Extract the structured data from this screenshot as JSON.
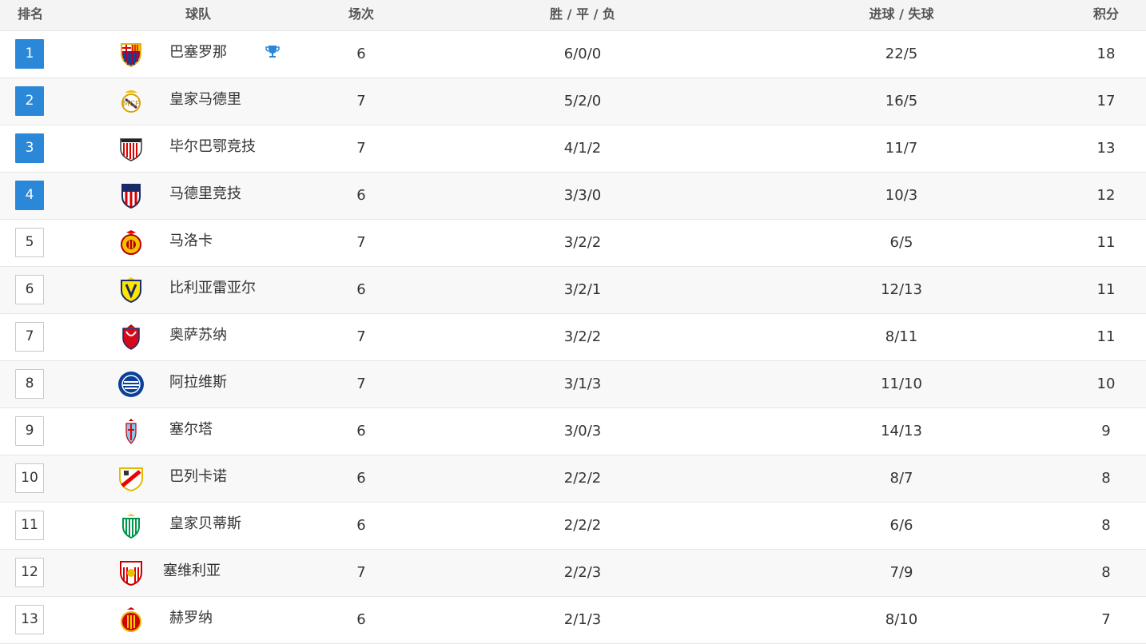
{
  "header": {
    "rank": "排名",
    "team": "球队",
    "played": "场次",
    "wdl": "胜 / 平 / 负",
    "goals": "进球 / 失球",
    "points": "积分"
  },
  "accent_color": "#2b88d8",
  "rows": [
    {
      "rank": "1",
      "team": "巴塞罗那",
      "played": "6",
      "wdl": "6/0/0",
      "goals": "22/5",
      "points": "18",
      "crest": "barcelona-crest-icon",
      "highlight": true,
      "leader": true
    },
    {
      "rank": "2",
      "team": "皇家马德里",
      "played": "7",
      "wdl": "5/2/0",
      "goals": "16/5",
      "points": "17",
      "crest": "real-madrid-crest-icon",
      "highlight": true
    },
    {
      "rank": "3",
      "team": "毕尔巴鄂竞技",
      "played": "7",
      "wdl": "4/1/2",
      "goals": "11/7",
      "points": "13",
      "crest": "athletic-bilbao-crest-icon",
      "highlight": true
    },
    {
      "rank": "4",
      "team": "马德里竞技",
      "played": "6",
      "wdl": "3/3/0",
      "goals": "10/3",
      "points": "12",
      "crest": "atletico-madrid-crest-icon",
      "highlight": true
    },
    {
      "rank": "5",
      "team": "马洛卡",
      "played": "7",
      "wdl": "3/2/2",
      "goals": "6/5",
      "points": "11",
      "crest": "mallorca-crest-icon"
    },
    {
      "rank": "6",
      "team": "比利亚雷亚尔",
      "played": "6",
      "wdl": "3/2/1",
      "goals": "12/13",
      "points": "11",
      "crest": "villarreal-crest-icon"
    },
    {
      "rank": "7",
      "team": "奥萨苏纳",
      "played": "7",
      "wdl": "3/2/2",
      "goals": "8/11",
      "points": "11",
      "crest": "osasuna-crest-icon"
    },
    {
      "rank": "8",
      "team": "阿拉维斯",
      "played": "7",
      "wdl": "3/1/3",
      "goals": "11/10",
      "points": "10",
      "crest": "alaves-crest-icon"
    },
    {
      "rank": "9",
      "team": "塞尔塔",
      "played": "6",
      "wdl": "3/0/3",
      "goals": "14/13",
      "points": "9",
      "crest": "celta-crest-icon"
    },
    {
      "rank": "10",
      "team": "巴列卡诺",
      "played": "6",
      "wdl": "2/2/2",
      "goals": "8/7",
      "points": "8",
      "crest": "rayo-vallecano-crest-icon"
    },
    {
      "rank": "11",
      "team": "皇家贝蒂斯",
      "played": "6",
      "wdl": "2/2/2",
      "goals": "6/6",
      "points": "8",
      "crest": "real-betis-crest-icon"
    },
    {
      "rank": "12",
      "team": "塞维利亚",
      "played": "7",
      "wdl": "2/2/3",
      "goals": "7/9",
      "points": "8",
      "crest": "sevilla-crest-icon"
    },
    {
      "rank": "13",
      "team": "赫罗纳",
      "played": "6",
      "wdl": "2/1/3",
      "goals": "8/10",
      "points": "7",
      "crest": "girona-crest-icon"
    }
  ]
}
